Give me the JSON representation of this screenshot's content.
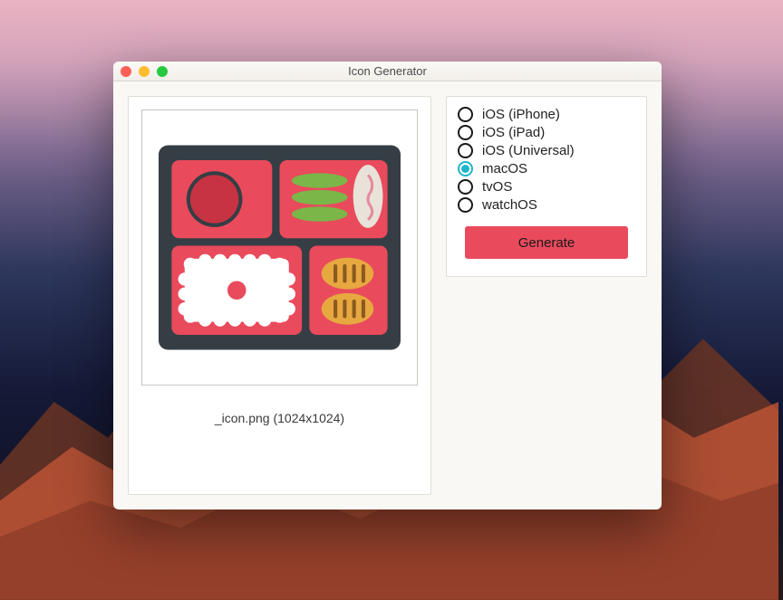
{
  "window": {
    "title": "Icon Generator"
  },
  "preview": {
    "filename_label": "_icon.png (1024x1024)"
  },
  "platforms": {
    "options": [
      {
        "label": "iOS (iPhone)",
        "selected": false
      },
      {
        "label": "iOS (iPad)",
        "selected": false
      },
      {
        "label": "iOS (Universal)",
        "selected": false
      },
      {
        "label": "macOS",
        "selected": true
      },
      {
        "label": "tvOS",
        "selected": false
      },
      {
        "label": "watchOS",
        "selected": false
      }
    ]
  },
  "actions": {
    "generate_label": "Generate"
  },
  "colors": {
    "accent_radio": "#1fb6cd",
    "button": "#e94a5c"
  }
}
